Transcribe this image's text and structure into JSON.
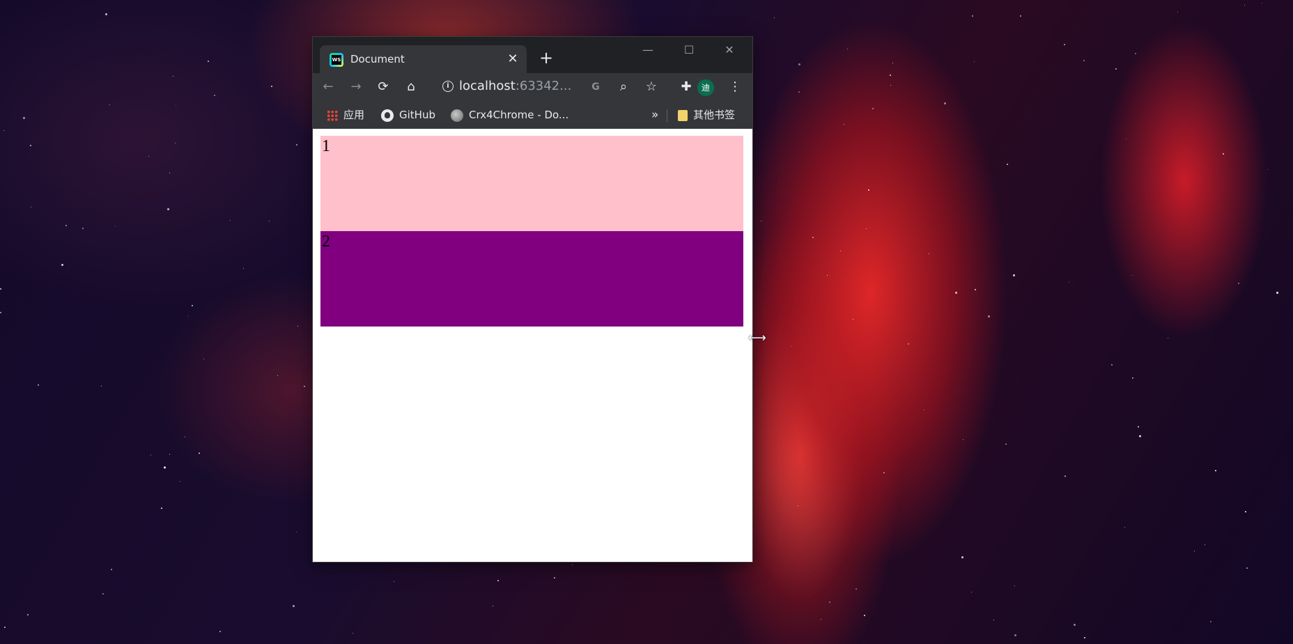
{
  "browser": {
    "tab": {
      "title": "Document",
      "close_symbol": "✕"
    },
    "new_tab_symbol": "+",
    "window_controls": {
      "minimize": "—",
      "maximize": "☐",
      "close": "✕"
    },
    "toolbar": {
      "back": "←",
      "forward": "→",
      "reload": "⟳",
      "home": "⌂",
      "url_host": "localhost",
      "url_rest": ":63342...",
      "translate": "G",
      "zoom": "⌕",
      "star": "☆",
      "extensions": "✚",
      "avatar_letter": "迪",
      "menu": "⋮"
    },
    "bookmarks": {
      "apps": "应用",
      "github": "GitHub",
      "crx": "Crx4Chrome - Do...",
      "overflow": "»",
      "other": "其他书签"
    }
  },
  "page": {
    "boxes": [
      {
        "label": "1",
        "color": "#ffc0cb"
      },
      {
        "label": "2",
        "color": "#800080"
      }
    ]
  },
  "cursor": {
    "symbol": "⟷"
  }
}
